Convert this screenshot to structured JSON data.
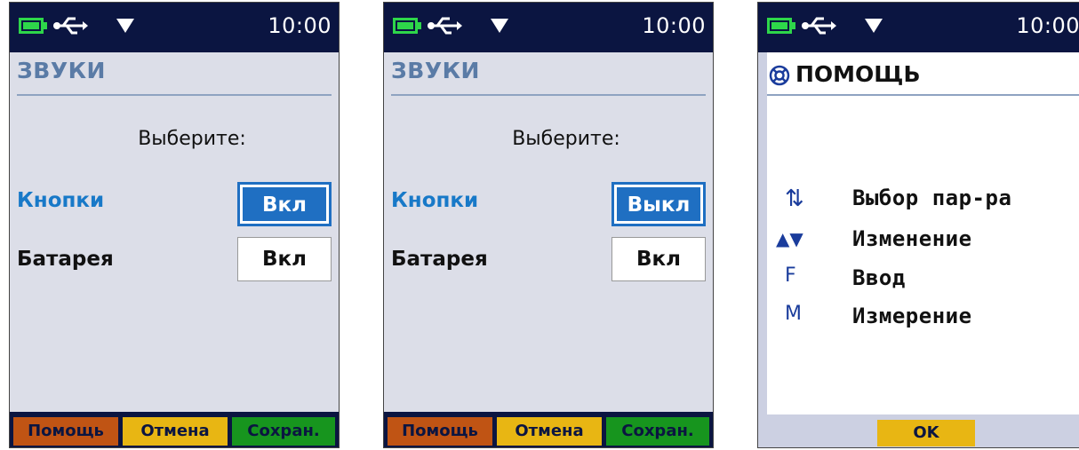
{
  "status": {
    "time": "10:00"
  },
  "screens": [
    {
      "title": "ЗВУКИ",
      "prompt": "Выберите:",
      "rows": [
        {
          "label": "Кнопки",
          "value": "Вкл"
        },
        {
          "label": "Батарея",
          "value": "Вкл"
        }
      ],
      "softkeys": {
        "help": "Помощь",
        "cancel": "Отмена",
        "save": "Сохран."
      }
    },
    {
      "title": "ЗВУКИ",
      "prompt": "Выберите:",
      "rows": [
        {
          "label": "Кнопки",
          "value": "Выкл"
        },
        {
          "label": "Батарея",
          "value": "Вкл"
        }
      ],
      "softkeys": {
        "help": "Помощь",
        "cancel": "Отмена",
        "save": "Сохран."
      }
    },
    {
      "title": "ПОМОЩЬ",
      "items": [
        {
          "symbol": "⇅",
          "text": "Выбор пар-ра"
        },
        {
          "symbol": "▲▼",
          "text": "Изменение"
        },
        {
          "symbol": "F",
          "text": "Ввод"
        },
        {
          "symbol": "M",
          "text": "Измерение"
        }
      ],
      "ok": "OK"
    }
  ],
  "colors": {
    "statusbar": "#0b1541",
    "battery": "#2ed64a",
    "accent_blue": "#1f6fc2",
    "softkey_help": "#c05414",
    "softkey_cancel": "#e8b613",
    "softkey_save": "#17951e"
  },
  "icons": [
    "battery-icon",
    "usb-icon",
    "signal-icon",
    "lifebuoy-icon"
  ]
}
